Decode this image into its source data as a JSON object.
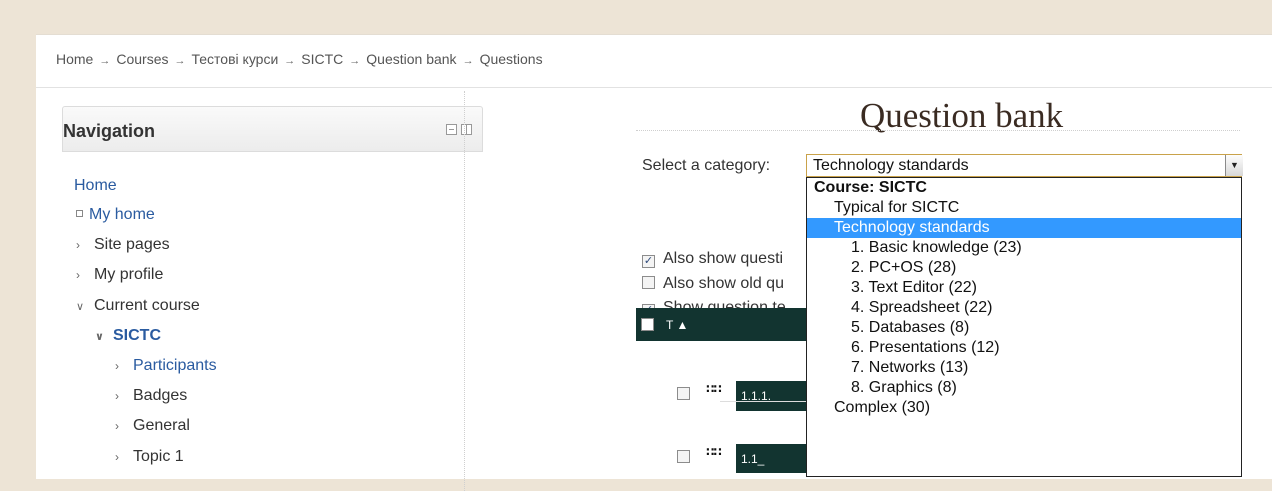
{
  "breadcrumb": [
    "Home",
    "Courses",
    "Тестові курси",
    "SICTC",
    "Question bank",
    "Questions"
  ],
  "breadcrumb_separator": "→",
  "navigation": {
    "title": "Navigation",
    "items": [
      {
        "label": "Home"
      },
      {
        "label": "My home"
      },
      {
        "label": "Site pages"
      },
      {
        "label": "My profile"
      },
      {
        "label": "Current course"
      },
      {
        "label": "SICTC"
      },
      {
        "label": "Participants"
      },
      {
        "label": "Badges"
      },
      {
        "label": "General"
      },
      {
        "label": "Topic 1"
      }
    ]
  },
  "main": {
    "title": "Question bank",
    "category_label": "Select a category:",
    "category_value": "Technology standards",
    "checkboxes": [
      {
        "label": "Also show questi",
        "checked": true
      },
      {
        "label": "Also show old qu",
        "checked": false
      },
      {
        "label": "Show question te",
        "checked": true
      }
    ],
    "table": {
      "header": "T",
      "sort_indicator": "▲",
      "rows": [
        {
          "name": "1.1.1."
        },
        {
          "name": "1.1_"
        }
      ]
    }
  },
  "dropdown": {
    "items": [
      {
        "label": "Course: SICTC",
        "level": 0,
        "group": true
      },
      {
        "label": "Typical for SICTC",
        "level": 1
      },
      {
        "label": "Technology standards",
        "level": 1,
        "selected": true
      },
      {
        "label": "1. Basic knowledge (23)",
        "level": 2
      },
      {
        "label": "2. PC+OS (28)",
        "level": 2
      },
      {
        "label": "3. Text Editor (22)",
        "level": 2
      },
      {
        "label": "4. Spreadsheet (22)",
        "level": 2
      },
      {
        "label": "5. Databases (8)",
        "level": 2
      },
      {
        "label": "6. Presentations (12)",
        "level": 2
      },
      {
        "label": "7. Networks (13)",
        "level": 2
      },
      {
        "label": "8. Graphics (8)",
        "level": 2
      },
      {
        "label": "Complex (30)",
        "level": 1
      }
    ]
  },
  "colors": {
    "page_background": "#ede4d6",
    "table_header": "#123430",
    "selection": "#3399ff",
    "link": "#2a5ba0"
  }
}
